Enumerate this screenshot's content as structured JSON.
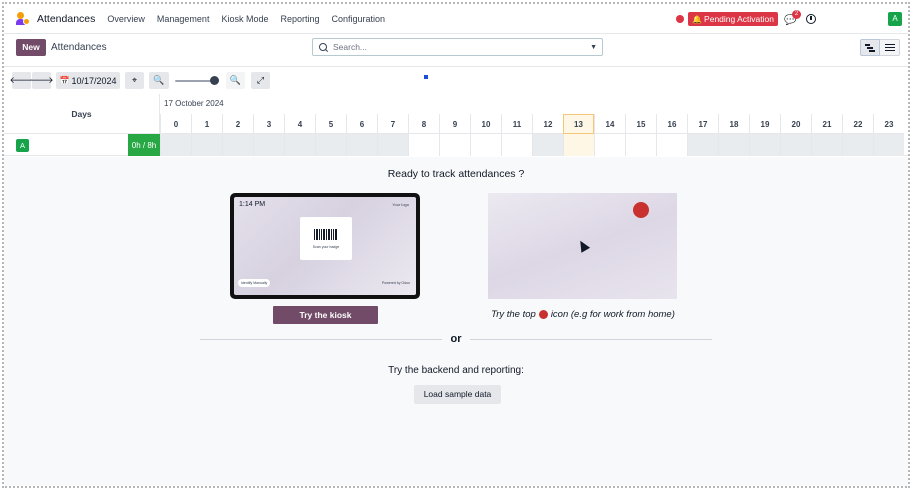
{
  "navbar": {
    "app_name": "Attendances",
    "menu": [
      "Overview",
      "Management",
      "Kiosk Mode",
      "Reporting",
      "Configuration"
    ],
    "pending_label": "Pending Activation",
    "chat_badge": "2",
    "avatar_initial": "A"
  },
  "control": {
    "new_label": "New",
    "breadcrumb": "Attendances",
    "search_placeholder": "Search..."
  },
  "toolbar": {
    "date_label": "10/17/2024"
  },
  "gantt": {
    "days_header": "Days",
    "date_header": "17 October 2024",
    "hours": [
      "0",
      "1",
      "2",
      "3",
      "4",
      "5",
      "6",
      "7",
      "8",
      "9",
      "10",
      "11",
      "12",
      "13",
      "14",
      "15",
      "16",
      "17",
      "18",
      "19",
      "20",
      "21",
      "22",
      "23"
    ],
    "today_hour": "13",
    "row": {
      "avatar_initial": "A",
      "total": "0h / 8h"
    }
  },
  "helper": {
    "title": "Ready to track attendances ?",
    "tablet": {
      "time": "1:14 PM",
      "logo_text": "Your logo",
      "scan_text": "Scan your badge",
      "manual_text": "Identify Manually",
      "powered_text": "Powered by Odoo"
    },
    "kiosk_button": "Try the kiosk",
    "try_top_before": "Try the top",
    "try_top_after": "icon (e.g for work from home)",
    "or_text": "or",
    "backend_text": "Try the backend and reporting:",
    "sample_button": "Load sample data"
  },
  "colors": {
    "brand": "#714b67",
    "danger": "#dc3545",
    "success": "#28a745",
    "today": "#fef7e6"
  }
}
